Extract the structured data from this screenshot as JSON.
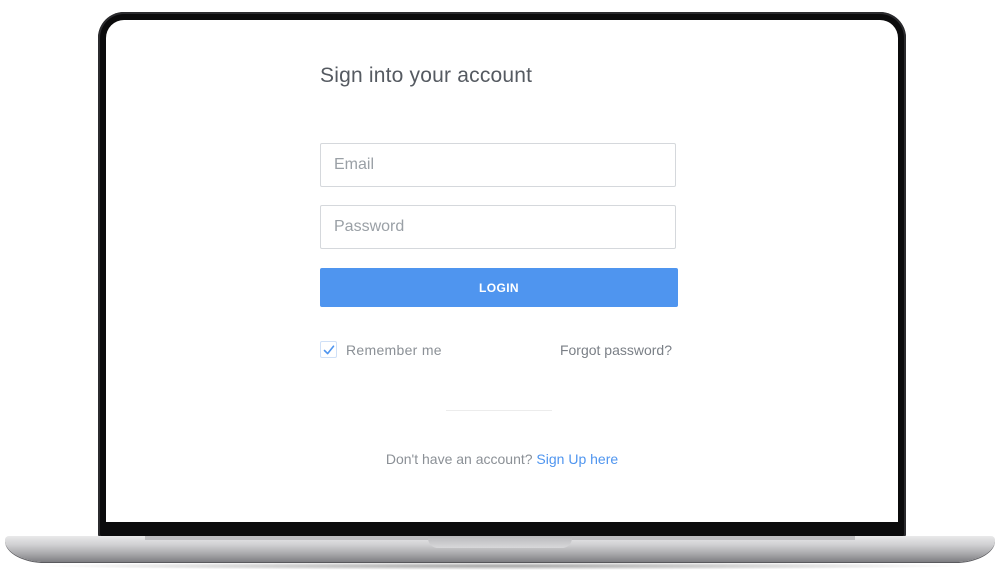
{
  "login": {
    "title": "Sign into your account",
    "email_placeholder": "Email",
    "password_placeholder": "Password",
    "login_label": "LOGIN",
    "remember_label": "Remember me",
    "remember_checked": true,
    "forgot_label": "Forgot password?",
    "signup_prompt": "Don't have an account?",
    "signup_link": "Sign Up here"
  },
  "colors": {
    "accent": "#4f95ef",
    "title_text": "#555a61",
    "muted_text": "#8b9096",
    "bezel": "#0b0b0c"
  },
  "icons": {
    "checkbox_mark": "check-icon"
  }
}
